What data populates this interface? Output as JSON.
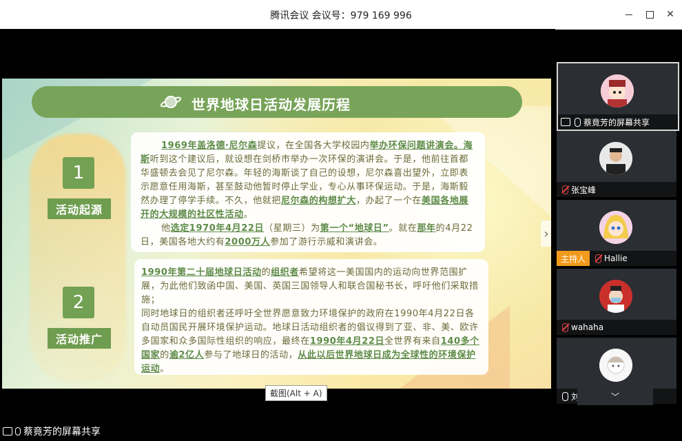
{
  "window": {
    "title": "腾讯会议 会议号：979 169 996"
  },
  "slide": {
    "title": "世界地球日活动发展历程",
    "section1": {
      "number": "1",
      "tag": "活动起源",
      "para1": [
        {
          "t": "1969年盖洛德·尼尔森",
          "h": true
        },
        {
          "t": "提议，在全国各大学校园内",
          "h": false
        },
        {
          "t": "举办环保问题讲演会。海斯",
          "h": true
        },
        {
          "t": "听到这个建议后，就设想在剑桥市举办一次环保的演讲会。于是，他前往首都华盛顿去会见了尼尔森。年轻的海斯谈了自己的设想，尼尔森喜出望外，立即表示愿意任用海斯，甚至鼓动他暂时停止学业，专心从事环保运动。于是，海斯毅然办理了停学手续。不久，他就把",
          "h": false
        },
        {
          "t": "尼尔森的构想扩大",
          "h": true
        },
        {
          "t": "，办起了一个在",
          "h": false
        },
        {
          "t": "美国各地展开的大规模的社区性活动",
          "h": true
        },
        {
          "t": "。",
          "h": false
        }
      ],
      "para2": [
        {
          "t": "他",
          "h": false
        },
        {
          "t": "选定1970年4月22日",
          "h": true
        },
        {
          "t": "（星期三）为",
          "h": false
        },
        {
          "t": "第一个“地球日”",
          "h": true
        },
        {
          "t": "。就在",
          "h": false
        },
        {
          "t": "那年",
          "h": true
        },
        {
          "t": "的4月22日，美国各地大约有",
          "h": false
        },
        {
          "t": "2000万人",
          "h": true
        },
        {
          "t": "参加了游行示威和演讲会。",
          "h": false
        }
      ]
    },
    "section2": {
      "number": "2",
      "tag": "活动推广",
      "para1": [
        {
          "t": "1990年第二十届地球日活动",
          "h": true
        },
        {
          "t": "的",
          "h": false
        },
        {
          "t": "组织者",
          "h": true
        },
        {
          "t": "希望将这一美国国内的运动向世界范围扩展，为此他们致函中国、美国、英国三国领导人和联合国秘书长，呼吁他们采取措施；",
          "h": false
        }
      ],
      "para2": [
        {
          "t": "同时地球日的组织者还呼吁全世界愿意致力环境保护的政府在1990年4月22日各自动员国民开展环境保护运动。地球日活动组织者的倡议得到了亚、非、美、欧许多国家和众多国际性组织的响应，最终在",
          "h": false
        },
        {
          "t": "1990年4月22日",
          "h": true
        },
        {
          "t": "全世界有来自",
          "h": false
        },
        {
          "t": "140多个国家",
          "h": true
        },
        {
          "t": "的",
          "h": false
        },
        {
          "t": "逾2亿人",
          "h": true
        },
        {
          "t": "参与了地球日的活动，",
          "h": false
        },
        {
          "t": "从此以后世界地球日成为全球性的环境保护运动",
          "h": true
        },
        {
          "t": "。",
          "h": false
        }
      ]
    }
  },
  "tooltip": "截图(Alt + A)",
  "sharer_label": "蔡竟芳的屏幕共享",
  "participants": [
    {
      "name": "蔡竟芳的屏幕共享",
      "host": false,
      "muted": false,
      "sharing": true,
      "active": true
    },
    {
      "name": "张宝峰",
      "host": false,
      "muted": true,
      "sharing": false,
      "active": false
    },
    {
      "name": "Hallie",
      "host": true,
      "host_label": "主持人",
      "muted": true,
      "sharing": false,
      "active": false
    },
    {
      "name": "wahaha",
      "host": false,
      "muted": true,
      "sharing": false,
      "active": false
    },
    {
      "name": "刘栋",
      "host": false,
      "muted": false,
      "sharing": false,
      "active": false
    }
  ],
  "colors": {
    "banner": "#78a459",
    "highlight": "#5e8b48",
    "host": "#f29a1b"
  }
}
